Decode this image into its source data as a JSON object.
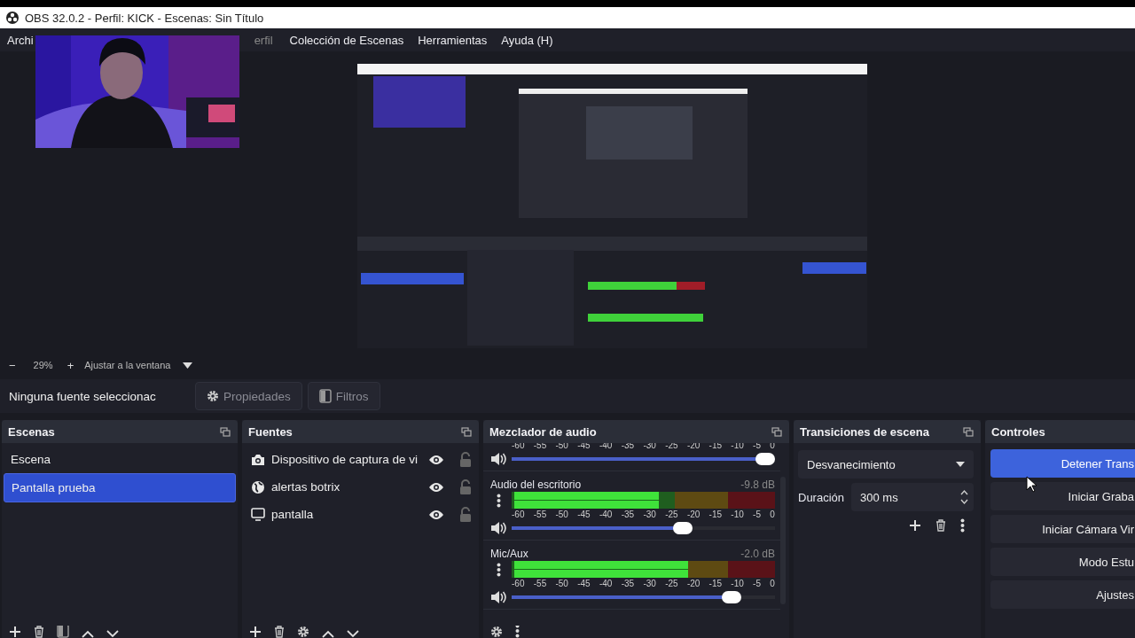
{
  "window": {
    "title": "OBS 32.0.2 - Perfil: KICK - Escenas: Sin Título"
  },
  "menu": [
    {
      "label": "Archi"
    },
    {
      "label": "erfil"
    },
    {
      "label": "Colección de Escenas"
    },
    {
      "label": "Herramientas"
    },
    {
      "label": "Ayuda (H)"
    }
  ],
  "zoom_bar": {
    "zoom_out": "−",
    "zoom": "29%",
    "zoom_in": "+",
    "fit": "Ajustar a la ventana"
  },
  "source_toolbar": {
    "status": "Ninguna fuente seleccionac",
    "buttons": [
      {
        "kind": "properties",
        "label": "Propiedades",
        "disabled": true
      },
      {
        "kind": "filters",
        "label": "Filtros",
        "disabled": true
      }
    ]
  },
  "scenes": {
    "title": "Escenas",
    "items": [
      {
        "label": "Escena",
        "selected": false
      },
      {
        "label": "Pantalla prueba",
        "selected": true
      }
    ]
  },
  "sources": {
    "title": "Fuentes",
    "items": [
      {
        "kind": "camera",
        "label": "Dispositivo de captura de vi",
        "visible": true,
        "locked": false
      },
      {
        "kind": "browser",
        "label": "alertas botrix",
        "visible": true,
        "locked": false
      },
      {
        "kind": "display",
        "label": "pantalla",
        "visible": true,
        "locked": false
      }
    ]
  },
  "mixer": {
    "title": "Mezclador de audio",
    "channels": [
      {
        "scale": [
          "-60",
          "-55",
          "-50",
          "-45",
          "-40",
          "-35",
          "-30",
          "-25",
          "-20",
          "-15",
          "-10",
          "-5",
          "0"
        ],
        "volume": {
          "level": 1.0
        }
      },
      {
        "name": "Audio del escritorio",
        "reading": "-9.8 dB",
        "meter": {
          "level": 0.55
        },
        "scale": [
          "-60",
          "-55",
          "-50",
          "-45",
          "-40",
          "-35",
          "-30",
          "-25",
          "-20",
          "-15",
          "-10",
          "-5",
          "0"
        ],
        "volume": {
          "level": 0.66
        }
      },
      {
        "name": "Mic/Aux",
        "reading": "-2.0 dB",
        "meter": {
          "level": 0.66
        },
        "scale": [
          "-60",
          "-55",
          "-50",
          "-45",
          "-40",
          "-35",
          "-30",
          "-25",
          "-20",
          "-15",
          "-10",
          "-5",
          "0"
        ],
        "volume": {
          "level": 0.86
        }
      }
    ]
  },
  "transitions": {
    "title": "Transiciones de escena",
    "transition": "Desvanecimiento",
    "duration_label": "Duración",
    "duration": "300 ms"
  },
  "controls": {
    "title": "Controles",
    "buttons": [
      {
        "label": "Detener Trans",
        "active": true
      },
      {
        "label": "Iniciar Graba",
        "active": false
      },
      {
        "label": "Iniciar Cámara Vir",
        "active": false
      },
      {
        "label": "Modo Estu",
        "active": false
      },
      {
        "label": "Ajustes",
        "active": false
      }
    ]
  }
}
